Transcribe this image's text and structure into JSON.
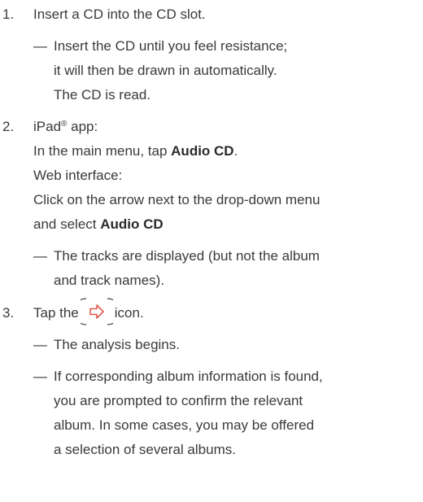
{
  "steps": [
    {
      "number": "1.",
      "lines": [
        "Insert a CD into the CD slot."
      ],
      "results": [
        {
          "dash": "—",
          "lines": [
            "Insert the CD until you feel resistance;",
            "it will then be drawn in automatically.",
            "The CD is read."
          ]
        }
      ]
    },
    {
      "number": "2.",
      "ipad_prefix": "iPad",
      "ipad_reg": "®",
      "ipad_suffix": " app:",
      "menu_pre": "In the main menu, tap ",
      "menu_bold": "Audio CD",
      "menu_post": ".",
      "web_label": "Web interface:",
      "click_line": "Click on the arrow next to the drop-down menu",
      "select_pre": "and select ",
      "select_bold": "Audio CD",
      "results": [
        {
          "dash": "—",
          "lines": [
            "The tracks are displayed (but not the album",
            "and track names)."
          ]
        }
      ]
    },
    {
      "number": "3.",
      "tap_pre": "Tap the",
      "tap_post": "icon.",
      "icon": "forward-arrow-icon",
      "results": [
        {
          "dash": "—",
          "lines": [
            "The analysis begins."
          ]
        },
        {
          "dash": "—",
          "lines": [
            "If corresponding album information is found,",
            "you are prompted to confirm the relevant",
            "album. In some cases, you may be offered",
            "a selection of several albums."
          ]
        }
      ]
    }
  ],
  "colors": {
    "text": "#3a3a3a",
    "icon": "#e05a4c"
  }
}
